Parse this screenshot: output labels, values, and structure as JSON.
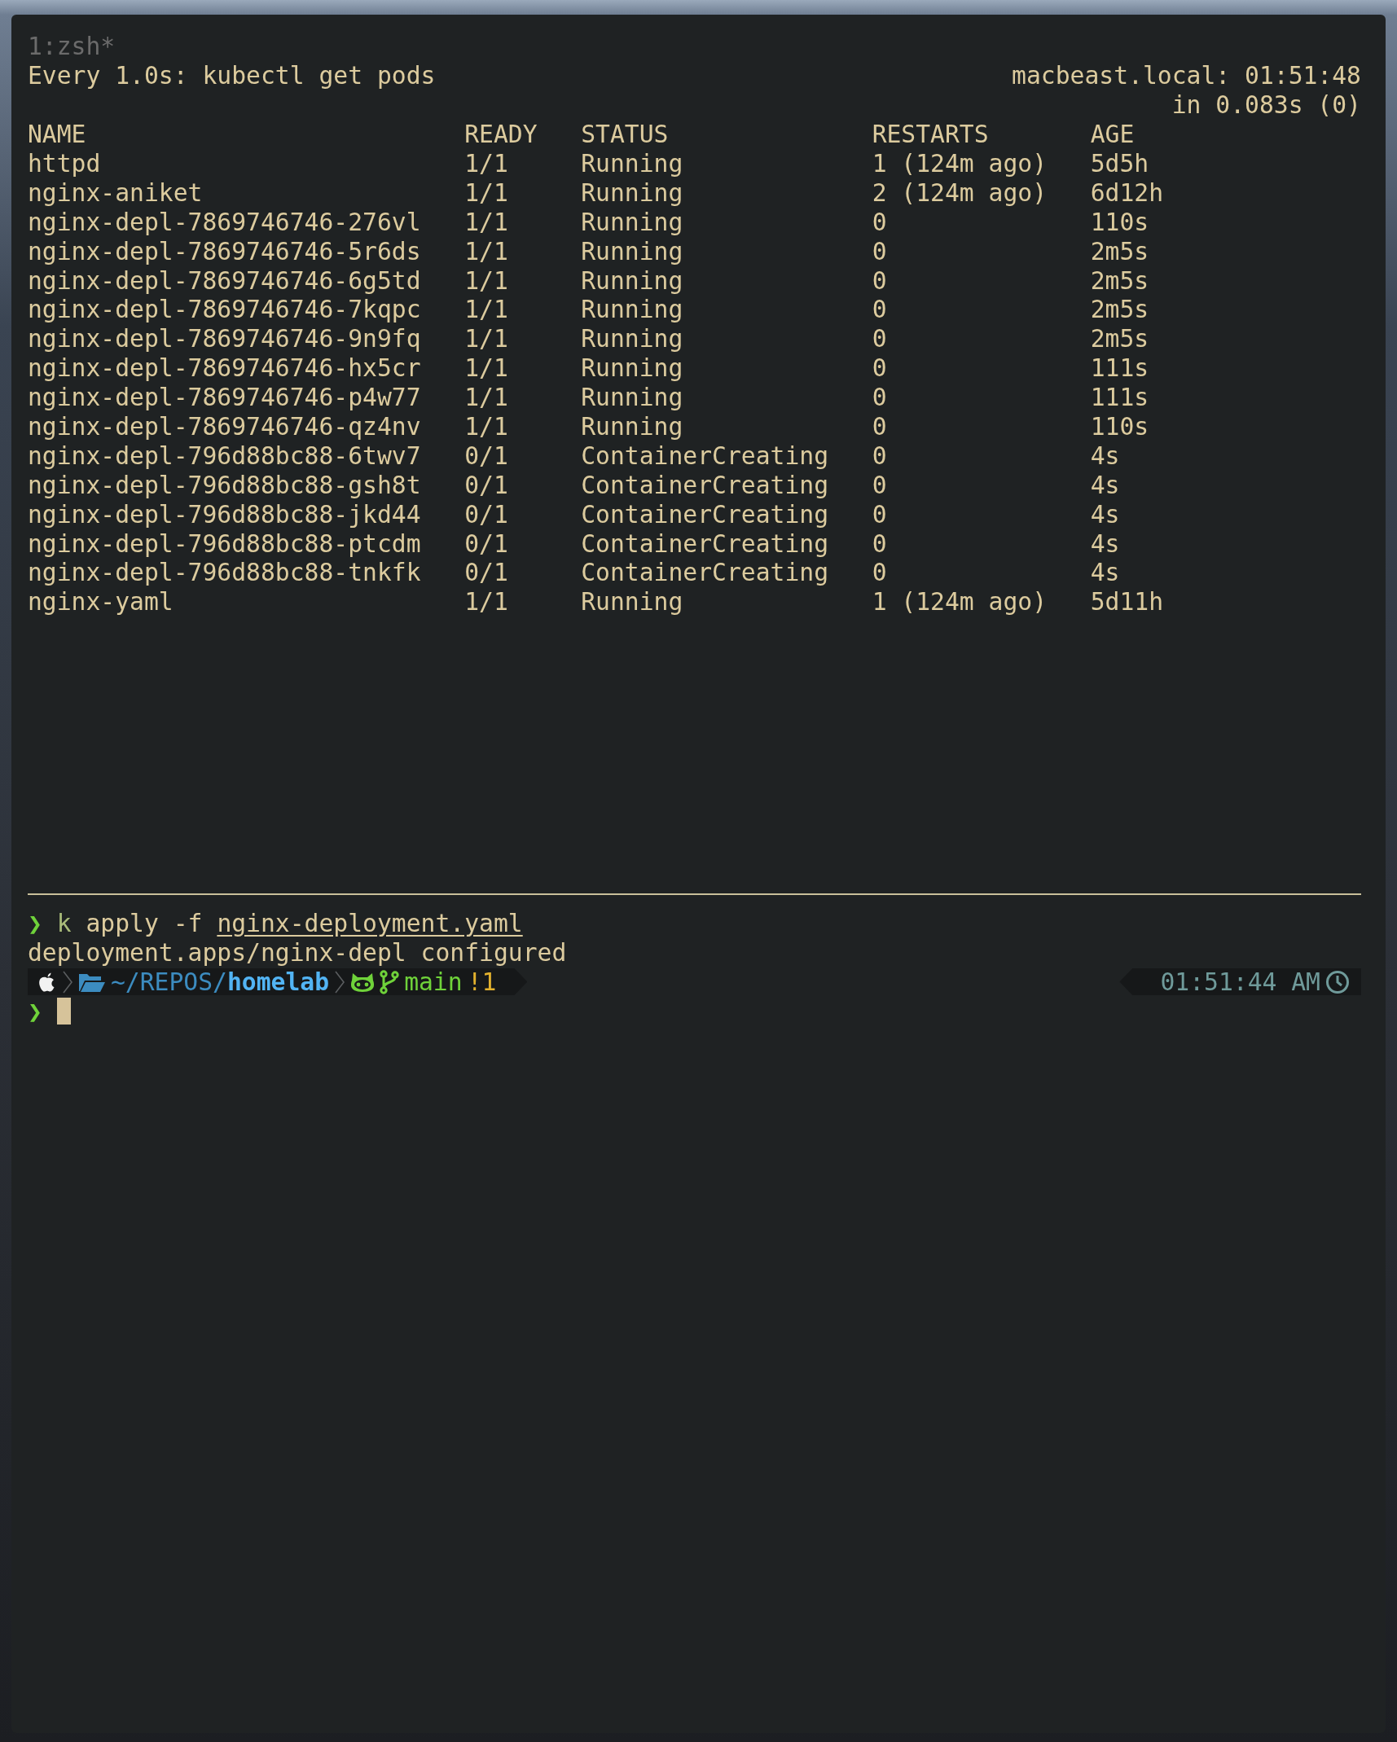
{
  "tab": {
    "label": "1:zsh*"
  },
  "watch": {
    "command": "Every 1.0s: kubectl get pods",
    "host_time": "macbeast.local: 01:51:48",
    "duration": "in 0.083s (0)"
  },
  "table": {
    "columns": [
      "NAME",
      "READY",
      "STATUS",
      "RESTARTS",
      "AGE"
    ],
    "rows": [
      [
        "httpd",
        "1/1",
        "Running",
        "1 (124m ago)",
        "5d5h"
      ],
      [
        "nginx-aniket",
        "1/1",
        "Running",
        "2 (124m ago)",
        "6d12h"
      ],
      [
        "nginx-depl-7869746746-276vl",
        "1/1",
        "Running",
        "0",
        "110s"
      ],
      [
        "nginx-depl-7869746746-5r6ds",
        "1/1",
        "Running",
        "0",
        "2m5s"
      ],
      [
        "nginx-depl-7869746746-6g5td",
        "1/1",
        "Running",
        "0",
        "2m5s"
      ],
      [
        "nginx-depl-7869746746-7kqpc",
        "1/1",
        "Running",
        "0",
        "2m5s"
      ],
      [
        "nginx-depl-7869746746-9n9fq",
        "1/1",
        "Running",
        "0",
        "2m5s"
      ],
      [
        "nginx-depl-7869746746-hx5cr",
        "1/1",
        "Running",
        "0",
        "111s"
      ],
      [
        "nginx-depl-7869746746-p4w77",
        "1/1",
        "Running",
        "0",
        "111s"
      ],
      [
        "nginx-depl-7869746746-qz4nv",
        "1/1",
        "Running",
        "0",
        "110s"
      ],
      [
        "nginx-depl-796d88bc88-6twv7",
        "0/1",
        "ContainerCreating",
        "0",
        "4s"
      ],
      [
        "nginx-depl-796d88bc88-gsh8t",
        "0/1",
        "ContainerCreating",
        "0",
        "4s"
      ],
      [
        "nginx-depl-796d88bc88-jkd44",
        "0/1",
        "ContainerCreating",
        "0",
        "4s"
      ],
      [
        "nginx-depl-796d88bc88-ptcdm",
        "0/1",
        "ContainerCreating",
        "0",
        "4s"
      ],
      [
        "nginx-depl-796d88bc88-tnkfk",
        "0/1",
        "ContainerCreating",
        "0",
        "4s"
      ],
      [
        "nginx-yaml",
        "1/1",
        "Running",
        "1 (124m ago)",
        "5d11h"
      ]
    ]
  },
  "command_line": {
    "prompt": "❯",
    "command": "k",
    "args": "apply -f",
    "file": "nginx-deployment.yaml"
  },
  "output": "deployment.apps/nginx-depl configured",
  "prompt_bar": {
    "path_prefix": "~/REPOS/",
    "path_dir": "homelab",
    "branch": "main",
    "git_status": "!1",
    "time": "01:51:44 AM"
  },
  "input_line": {
    "prompt": "❯"
  }
}
